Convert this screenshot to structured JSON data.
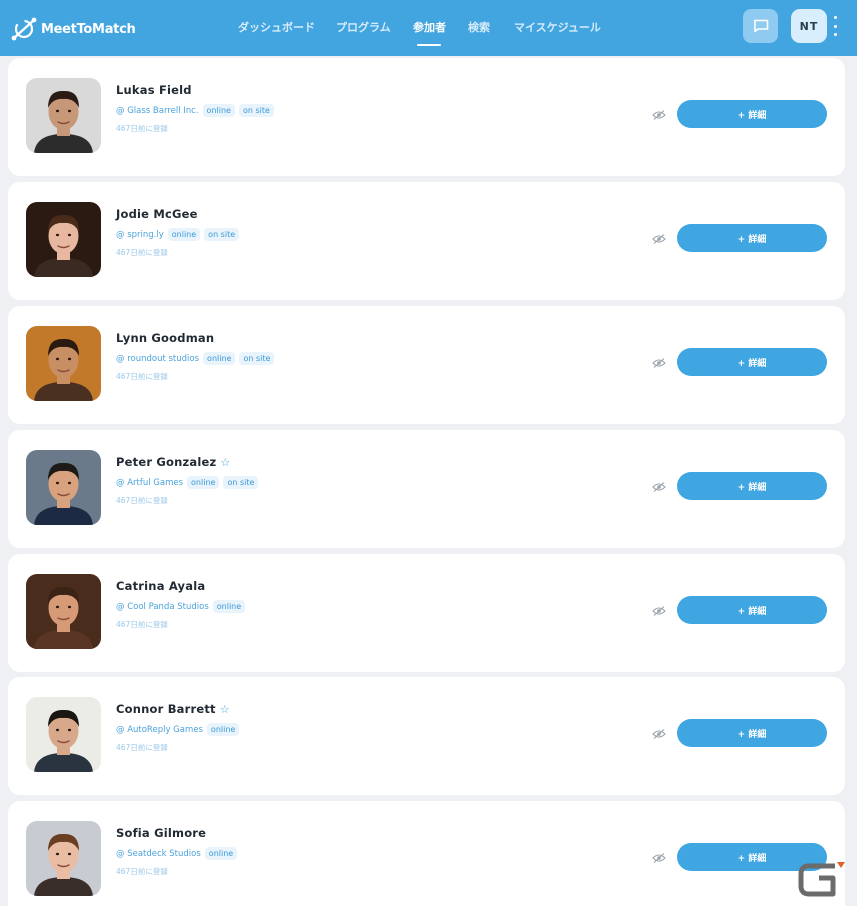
{
  "app": {
    "logo_text": "MeetToMatch",
    "nav": [
      {
        "label": "ダッシュボード"
      },
      {
        "label": "プログラム"
      },
      {
        "label": "参加者"
      },
      {
        "label": "検索"
      },
      {
        "label": "マイスケジュール"
      }
    ],
    "user_initials": "NT"
  },
  "attendees": [
    {
      "name": "Lukas Field",
      "org": "@ Glass Barrell Inc.",
      "tags": [
        "online",
        "on site"
      ],
      "registered": "467日前に登録",
      "starred": false,
      "detail_label": "+ 詳細",
      "skin": "#c79878",
      "hair": "#2a1c14",
      "bg": "#d9d9d9",
      "shirt": "#2c2c2c"
    },
    {
      "name": "Jodie McGee",
      "org": "@ spring.ly",
      "tags": [
        "online",
        "on site"
      ],
      "registered": "467日前に登録",
      "starred": false,
      "detail_label": "+ 詳細",
      "skin": "#e8b79f",
      "hair": "#4a2a18",
      "bg": "#2a1a12",
      "shirt": "#3a2a22"
    },
    {
      "name": "Lynn Goodman",
      "org": "@ roundout studios",
      "tags": [
        "online",
        "on site"
      ],
      "registered": "467日前に登録",
      "starred": false,
      "detail_label": "+ 詳細",
      "skin": "#c78f63",
      "hair": "#2a1a10",
      "bg": "#c27a2a",
      "shirt": "#4a3020"
    },
    {
      "name": "Peter Gonzalez",
      "org": "@ Artful Games",
      "tags": [
        "online",
        "on site"
      ],
      "registered": "467日前に登録",
      "starred": true,
      "detail_label": "+ 詳細",
      "skin": "#d9a27e",
      "hair": "#1e1a18",
      "bg": "#6a7a8a",
      "shirt": "#1d2a44"
    },
    {
      "name": "Catrina Ayala",
      "org": "@ Cool Panda Studios",
      "tags": [
        "online"
      ],
      "registered": "467日前に登録",
      "starred": false,
      "detail_label": "+ 詳細",
      "skin": "#d69a77",
      "hair": "#3a2214",
      "bg": "#4a2c1c",
      "shirt": "#5a3424"
    },
    {
      "name": "Connor Barrett",
      "org": "@ AutoReply Games",
      "tags": [
        "online"
      ],
      "registered": "467日前に登録",
      "starred": true,
      "detail_label": "+ 詳細",
      "skin": "#d8a88a",
      "hair": "#1a1614",
      "bg": "#ecece6",
      "shirt": "#2a3440"
    },
    {
      "name": "Sofia Gilmore",
      "org": "@ Seatdeck Studios",
      "tags": [
        "online"
      ],
      "registered": "467日前に登録",
      "starred": false,
      "detail_label": "+ 詳細",
      "skin": "#e9bda3",
      "hair": "#6a3e22",
      "bg": "#c9cbd2",
      "shirt": "#3a2e2a"
    }
  ],
  "colors": {
    "accent": "#42a5e0",
    "button": "#3fa6e2",
    "tag_bg": "#e8f3fb"
  },
  "icons": {
    "logo": "meettomatch-logo-icon",
    "chat": "chat-icon",
    "more": "more-vertical-icon",
    "eye": "eye-slash-icon",
    "star": "star-icon"
  }
}
